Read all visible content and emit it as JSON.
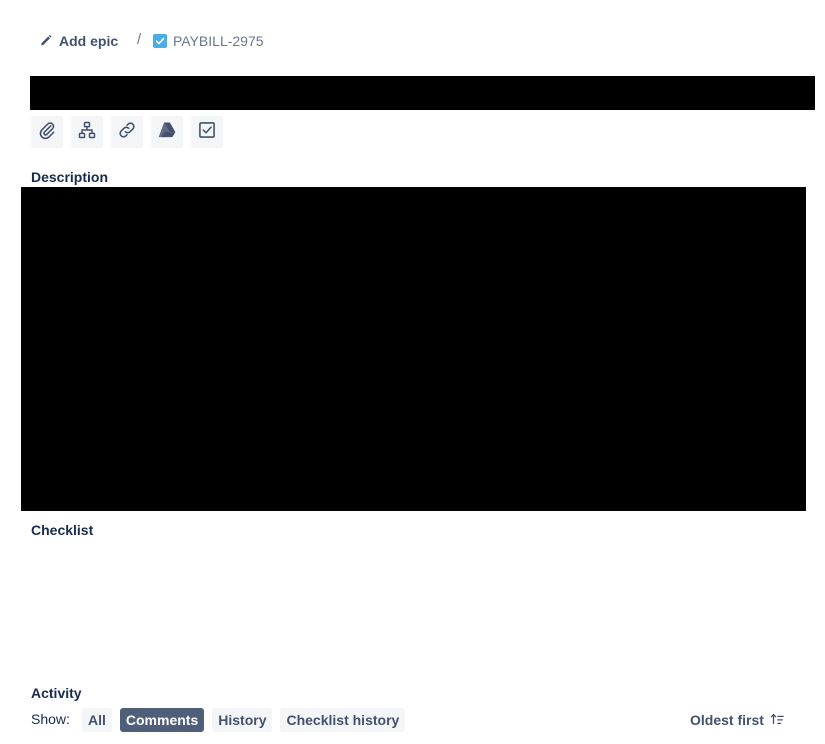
{
  "breadcrumb": {
    "add_epic_label": "Add epic",
    "add_epic_icon": "pencil-icon",
    "separator": "/",
    "issue_key": "PAYBILL-2975",
    "issue_type_icon": "task-checkbox-icon"
  },
  "toolbar": {
    "buttons": [
      {
        "icon": "paperclip-icon"
      },
      {
        "icon": "child-issues-icon"
      },
      {
        "icon": "link-icon"
      },
      {
        "icon": "google-drive-icon"
      },
      {
        "icon": "checklist-icon"
      }
    ]
  },
  "sections": {
    "description": "Description",
    "checklist": "Checklist",
    "activity": "Activity"
  },
  "activity": {
    "show_label": "Show:",
    "filters": [
      "All",
      "Comments",
      "History",
      "Checklist history"
    ],
    "active_filter": "Comments",
    "sort_label": "Oldest first",
    "sort_icon": "sort-ascending-icon"
  },
  "colors": {
    "text": "#172B4D",
    "muted": "#42526E",
    "button_bg": "#F4F5F7",
    "active_filter_bg": "#505F79",
    "task_blue": "#4BADE8"
  }
}
